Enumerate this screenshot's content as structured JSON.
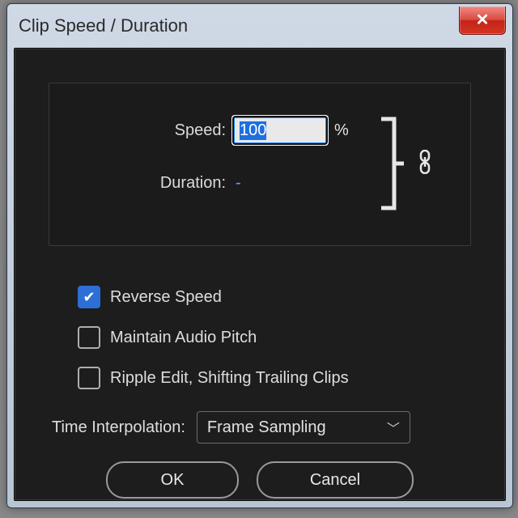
{
  "window": {
    "title": "Clip Speed / Duration"
  },
  "speed": {
    "label": "Speed:",
    "value": "100",
    "unit": "%"
  },
  "duration": {
    "label": "Duration:",
    "value": "-"
  },
  "link": {
    "locked": true
  },
  "checks": {
    "reverse": {
      "label": "Reverse Speed",
      "checked": true
    },
    "pitch": {
      "label": "Maintain Audio Pitch",
      "checked": false
    },
    "ripple": {
      "label": "Ripple Edit, Shifting Trailing Clips",
      "checked": false
    }
  },
  "interp": {
    "label": "Time Interpolation:",
    "selected": "Frame Sampling"
  },
  "buttons": {
    "ok": "OK",
    "cancel": "Cancel"
  }
}
